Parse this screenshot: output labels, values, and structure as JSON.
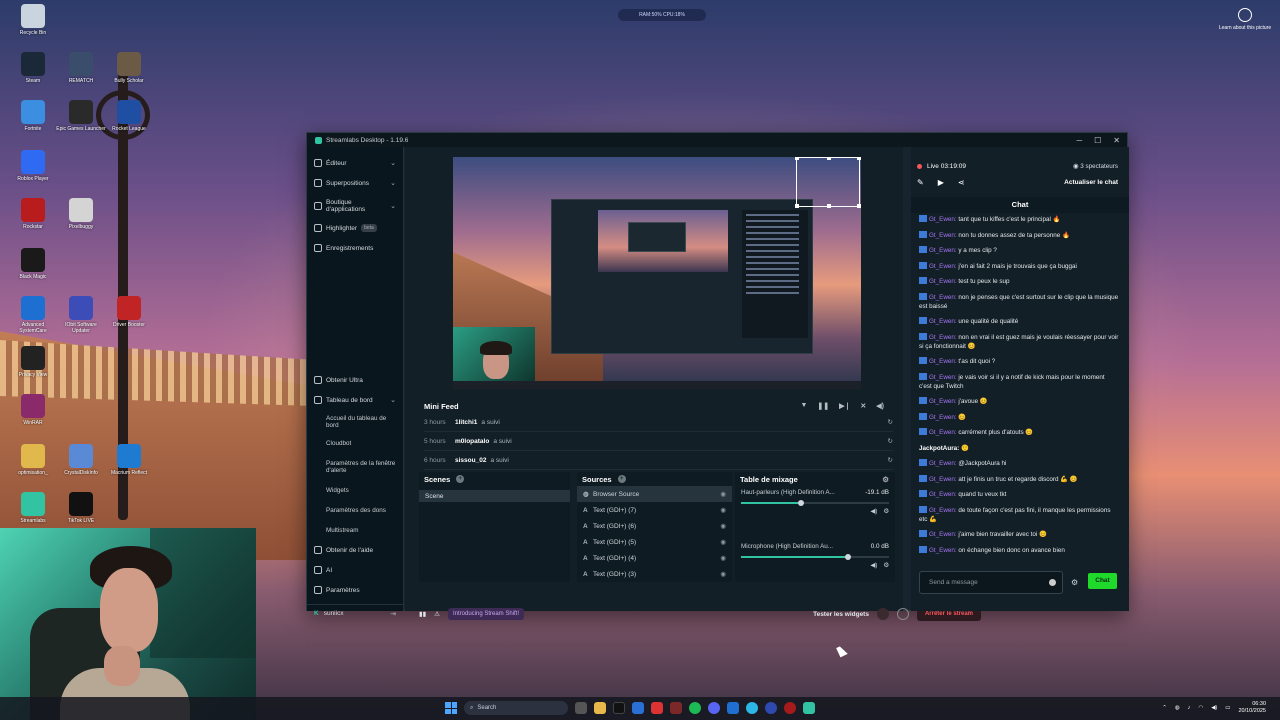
{
  "desktop": {
    "icons": [
      {
        "label": "Recycle Bin",
        "icon": "recycle-bin-icon",
        "color": "#c9d4de"
      },
      {
        "label": "Steam",
        "icon": "steam-icon",
        "color": "#1b2838"
      },
      {
        "label": "REMATCH",
        "icon": "rematch-icon",
        "color": "#3a4d6b"
      },
      {
        "label": "Bully Scholar",
        "icon": "bully-icon",
        "color": "#6b5a45"
      },
      {
        "label": "Fortnite",
        "icon": "fortnite-icon",
        "color": "#3b8ee0"
      },
      {
        "label": "Epic Games Launcher",
        "icon": "epic-games-icon",
        "color": "#2a2a2a"
      },
      {
        "label": "Rocket League",
        "icon": "rocket-league-icon",
        "color": "#1f4fa3"
      },
      {
        "label": "Roblox Player",
        "icon": "roblox-icon",
        "color": "#2e6bf2"
      },
      {
        "label": "Rockstar",
        "icon": "rockstar-icon",
        "color": "#b81c1c"
      },
      {
        "label": "Pixelbuggy",
        "icon": "pixelbuggy-icon",
        "color": "#d4d4d4"
      },
      {
        "label": "Black Magic",
        "icon": "blackmagic-icon",
        "color": "#1a1a1a"
      },
      {
        "label": "Advanced SystemCare",
        "icon": "systemcare-icon",
        "color": "#1d6fd1"
      },
      {
        "label": "IObit Software Updater",
        "icon": "iobit-icon",
        "color": "#3d4db8"
      },
      {
        "label": "Driver Booster",
        "icon": "driver-booster-icon",
        "color": "#c12424"
      },
      {
        "label": "Privacy View",
        "icon": "privacy-icon",
        "color": "#222"
      },
      {
        "label": "WinRAR",
        "icon": "winrar-icon",
        "color": "#8a2a6a"
      },
      {
        "label": "optimisation_",
        "icon": "folder-icon",
        "color": "#e0b84c"
      },
      {
        "label": "CrystalDiskInfo",
        "icon": "crystaldisk-icon",
        "color": "#5a8ad6"
      },
      {
        "label": "Macrium Reflect",
        "icon": "macrium-icon",
        "color": "#1e7bd1"
      },
      {
        "label": "Streamlabs",
        "icon": "streamlabs-icon",
        "color": "#31c3a2"
      },
      {
        "label": "TikTok LIVE",
        "icon": "tiktok-icon",
        "color": "#111"
      }
    ],
    "top_widget": "RAM:50% CPU:18%",
    "learn_about": "Learn about this picture"
  },
  "window": {
    "title": "Streamlabs Desktop - 1.19.6",
    "accent": "#31c3a2"
  },
  "sidebar": {
    "items": [
      {
        "label": "Éditeur",
        "chevron": true
      },
      {
        "label": "Superpositions",
        "chevron": true
      },
      {
        "label": "Boutique d'applications",
        "chevron": true
      },
      {
        "label": "Highlighter",
        "badge": "beta"
      },
      {
        "label": "Enregistrements"
      }
    ],
    "lower": [
      {
        "label": "Obtenir Ultra"
      },
      {
        "label": "Tableau de bord",
        "chevron": true
      }
    ],
    "subitems": [
      "Accueil du tableau de bord",
      "Cloudbot",
      "Paramètres de la fenêtre d'alerte",
      "Widgets",
      "Paramètres des dons",
      "Multistream"
    ],
    "bottom": [
      {
        "label": "Obtenir de l'aide"
      },
      {
        "label": "AI"
      },
      {
        "label": "Paramètres"
      }
    ],
    "user": "suniicx"
  },
  "minifeed": {
    "title": "Mini Feed",
    "rows": [
      {
        "time": "3 hours",
        "name": "1litchi1",
        "action": "a suivi"
      },
      {
        "time": "5 hours",
        "name": "m0lopatalo",
        "action": "a suivi"
      },
      {
        "time": "6 hours",
        "name": "sissou_02",
        "action": "a suivi"
      }
    ]
  },
  "scenes": {
    "title": "Scenes",
    "items": [
      "Scene"
    ]
  },
  "sources": {
    "title": "Sources",
    "items": [
      "Browser Source",
      "Text (GDI+) (7)",
      "Text (GDI+) (6)",
      "Text (GDI+) (5)",
      "Text (GDI+) (4)",
      "Text (GDI+) (3)"
    ]
  },
  "mixer": {
    "title": "Table de mixage",
    "channels": [
      {
        "name": "Haut-parleurs (High Definition A...",
        "db": "-19.1 dB",
        "level": 0.55
      },
      {
        "name": "Microphone (High Definition Au...",
        "db": "0.0 dB",
        "level": 1.0
      }
    ]
  },
  "bottombar": {
    "intro": "Introducing Stream Shift!",
    "test_widgets": "Tester les widgets",
    "stop": "Arrêter le stream"
  },
  "chat": {
    "live_time": "Live 03:19:09",
    "viewers": "3 spectateurs",
    "refresh": "Actualiser le chat",
    "header": "Chat",
    "messages": [
      {
        "user": "Gt_Ewen",
        "text": "tant que tu kiffes c'est le principal 🔥"
      },
      {
        "user": "Gt_Ewen",
        "text": "non tu donnes assez de ta personne 🔥"
      },
      {
        "user": "Gt_Ewen",
        "text": "y a mes clip ?"
      },
      {
        "user": "Gt_Ewen",
        "text": "j'en ai fait 2 mais je trouvais que ça buggai"
      },
      {
        "user": "Gt_Ewen",
        "text": "test tu peux le sup"
      },
      {
        "user": "Gt_Ewen",
        "text": "non je penses que c'est surtout sur le clip que la musique est baissé"
      },
      {
        "user": "Gt_Ewen",
        "text": "une qualité de qualité"
      },
      {
        "user": "Gt_Ewen",
        "text": "non en vrai il est guez mais je voulais réessayer pour voir si ça fonctionnait 😊"
      },
      {
        "user": "Gt_Ewen",
        "text": "t'as dit quoi ?"
      },
      {
        "user": "Gt_Ewen",
        "text": "je vais voir si il y a notif de kick mais pour le moment c'est que Twitch"
      },
      {
        "user": "Gt_Ewen",
        "text": "j'avoue 😊"
      },
      {
        "user": "Gt_Ewen",
        "text": "😊"
      },
      {
        "user": "Gt_Ewen",
        "text": "carrément plus d'atouts 😊"
      },
      {
        "user": "JackpotAura",
        "text": "🙂",
        "plain": true
      },
      {
        "user": "Gt_Ewen",
        "text": "@JackpotAura hi"
      },
      {
        "user": "Gt_Ewen",
        "text": "att je finis un truc et regarde discord 💪 😊"
      },
      {
        "user": "Gt_Ewen",
        "text": "quand tu veux tkt"
      },
      {
        "user": "Gt_Ewen",
        "text": "de toute façon c'est pas fini, il manque les permissions etc 💪"
      },
      {
        "user": "Gt_Ewen",
        "text": "j'aime bien travailler avec toi 😊"
      },
      {
        "user": "Gt_Ewen",
        "text": "on échange bien donc on avance bien"
      }
    ],
    "input_placeholder": "Send a message",
    "send": "Chat"
  },
  "taskbar": {
    "search": "Search",
    "time": "06:30",
    "date": "20/10/2025"
  }
}
